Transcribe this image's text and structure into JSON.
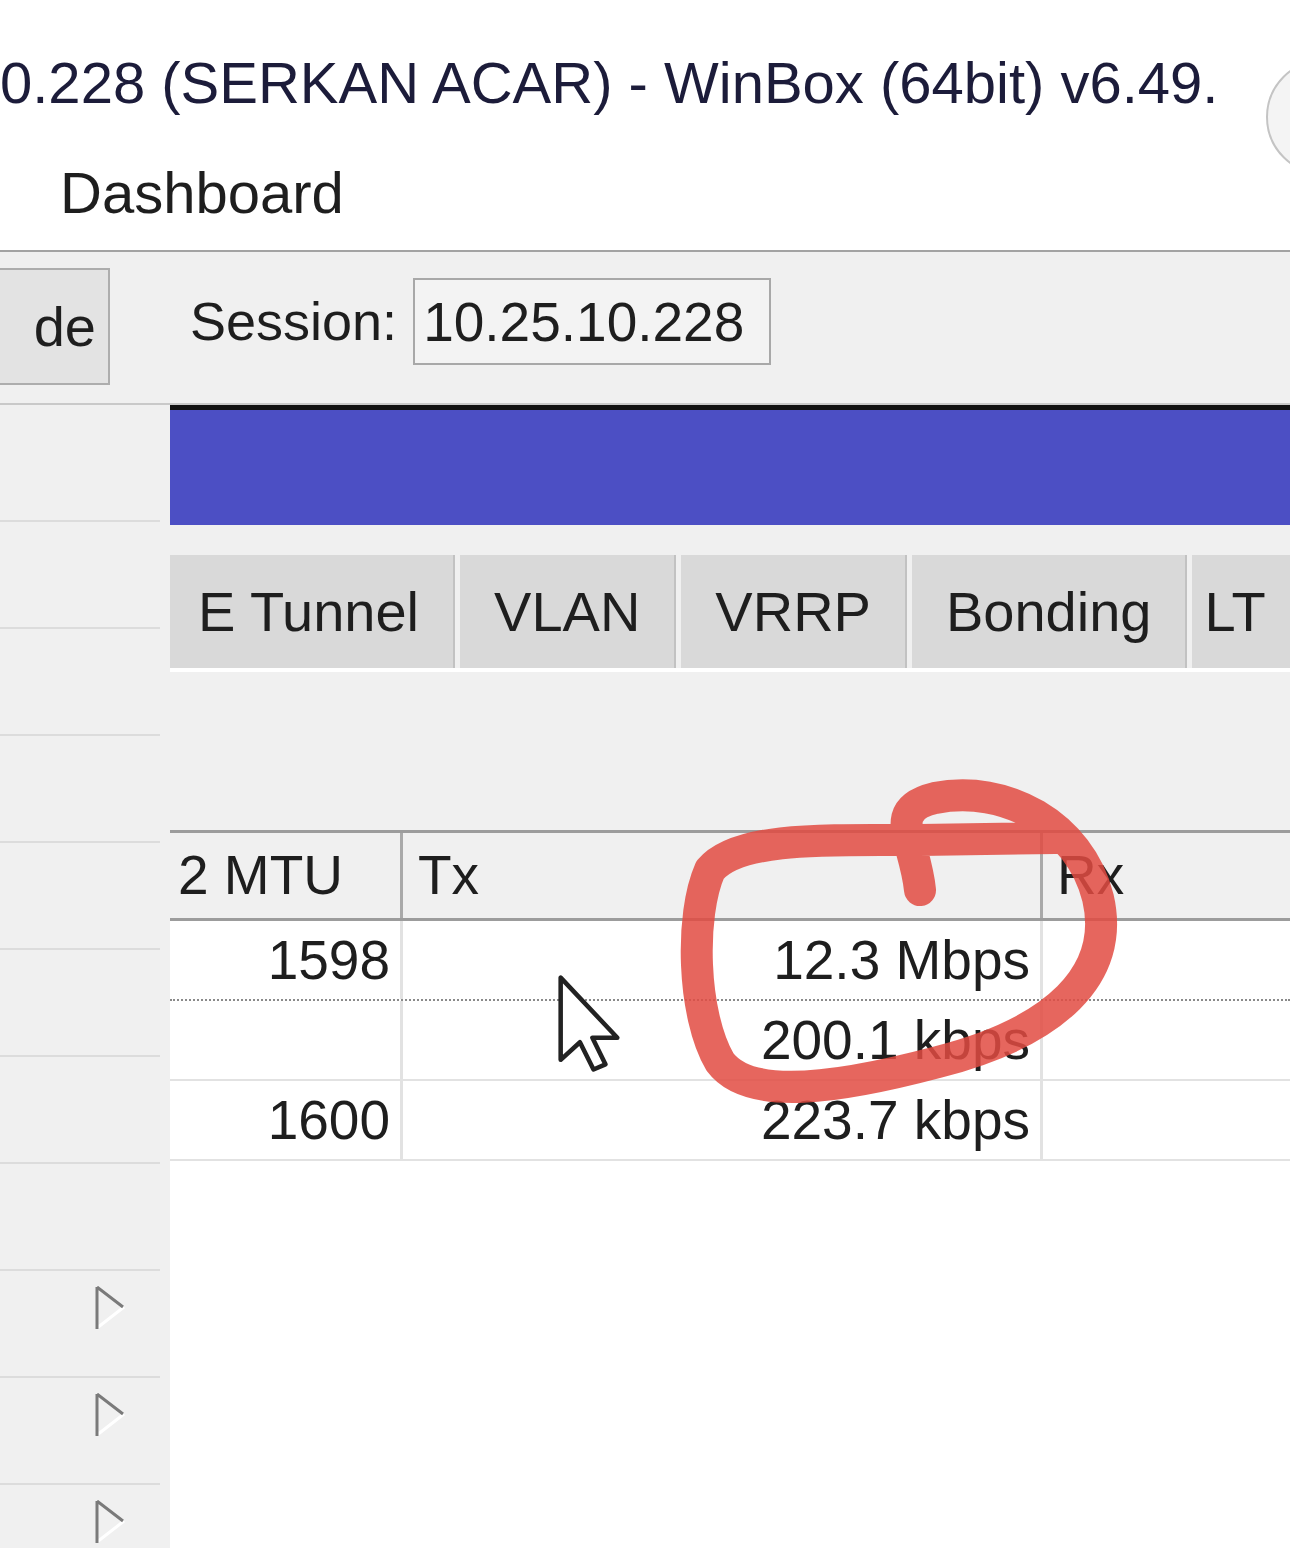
{
  "window": {
    "title": "0.228 (SERKAN ACAR) - WinBox (64bit) v6.49."
  },
  "menu": {
    "items": [
      {
        "label": "Dashboard"
      }
    ]
  },
  "toolbar": {
    "button": {
      "label": "de"
    },
    "session": {
      "label": "Session:",
      "value": "10.25.10.228"
    }
  },
  "sidebar": {
    "items": [
      {
        "submenu": false
      },
      {
        "submenu": false
      },
      {
        "submenu": false
      },
      {
        "submenu": false
      },
      {
        "submenu": false
      },
      {
        "submenu": false
      },
      {
        "submenu": false
      },
      {
        "submenu": false
      },
      {
        "submenu": true
      },
      {
        "submenu": true
      },
      {
        "submenu": true
      }
    ]
  },
  "tabs": [
    {
      "label": "E Tunnel",
      "selected": false
    },
    {
      "label": "VLAN",
      "selected": false
    },
    {
      "label": "VRRP",
      "selected": false
    },
    {
      "label": "Bonding",
      "selected": false
    },
    {
      "label": "LT",
      "selected": false
    }
  ],
  "table": {
    "columns": [
      {
        "label": "2 MTU"
      },
      {
        "label": "Tx"
      },
      {
        "label": "Rx"
      }
    ],
    "rows": [
      {
        "mtu": "1598",
        "tx": "12.3 Mbps",
        "dotted_divider": true
      },
      {
        "tx": "200.1 kbps",
        "dotted_divider": false
      },
      {
        "mtu": "1600",
        "tx": "223.7 kbps",
        "dotted_divider": false
      }
    ]
  }
}
